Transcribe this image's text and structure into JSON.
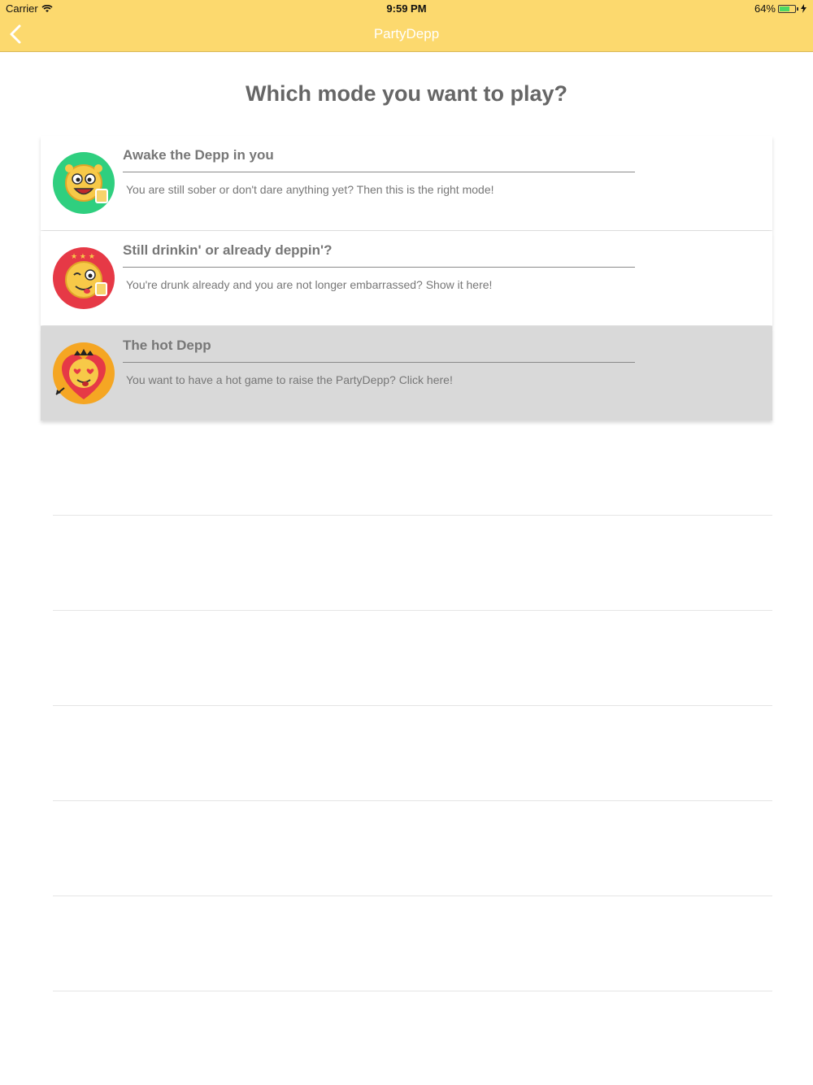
{
  "status_bar": {
    "carrier": "Carrier",
    "time": "9:59 PM",
    "battery": "64%"
  },
  "navbar": {
    "title": "PartyDepp",
    "back_icon": "chevron-left-icon"
  },
  "heading": "Which mode you want to play?",
  "modes": [
    {
      "title": "Awake the Depp in you",
      "description": "You are still sober or don't dare anything yet? Then this is the right mode!",
      "icon": "sober-emoji-icon",
      "selected": false
    },
    {
      "title": "Still drinkin' or already deppin'?",
      "description": "You're drunk already and you are not longer embarrassed? Show it here!",
      "icon": "drunk-emoji-icon",
      "selected": false
    },
    {
      "title": "The hot Depp",
      "description": "You want to have a hot game to raise the PartyDepp? Click here!",
      "icon": "hot-emoji-icon",
      "selected": true
    }
  ],
  "colors": {
    "navbar": "#fcd96e",
    "green": "#2fcf7f",
    "red": "#e63946",
    "orange": "#f5a623"
  }
}
